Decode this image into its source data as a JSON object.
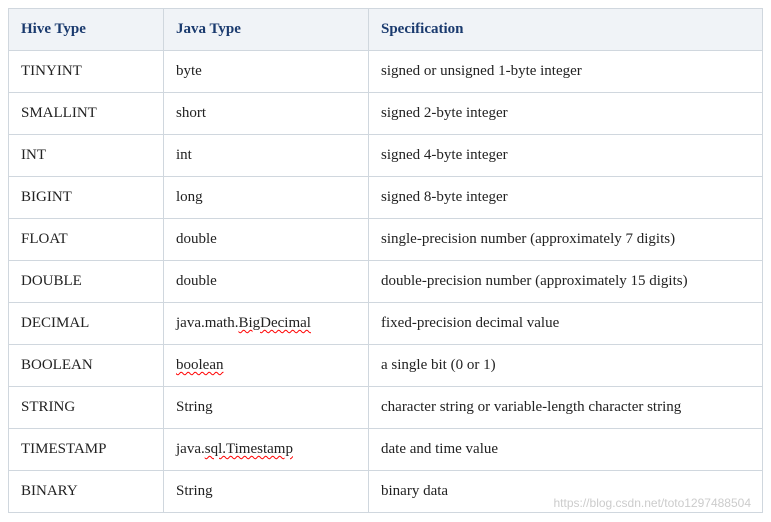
{
  "chart_data": {
    "type": "table",
    "headers": [
      "Hive Type",
      "Java Type",
      "Specification"
    ],
    "rows": [
      {
        "hive": "TINYINT",
        "java": "byte",
        "spec": "signed or unsigned 1-byte integer"
      },
      {
        "hive": "SMALLINT",
        "java": "short",
        "spec": "signed 2-byte integer"
      },
      {
        "hive": "INT",
        "java": "int",
        "spec": "signed 4-byte integer"
      },
      {
        "hive": "BIGINT",
        "java": "long",
        "spec": "signed 8-byte integer"
      },
      {
        "hive": "FLOAT",
        "java": "double",
        "spec": "single-precision number (approximately 7 digits)"
      },
      {
        "hive": "DOUBLE",
        "java": "double",
        "spec": "double-precision number (approximately 15 digits)"
      },
      {
        "hive": "DECIMAL",
        "java": "java.math.BigDecimal",
        "spec": "fixed-precision decimal value"
      },
      {
        "hive": "BOOLEAN",
        "java": "boolean",
        "spec": "a single bit (0 or 1)"
      },
      {
        "hive": "STRING",
        "java": "String",
        "spec": "character string or variable-length character string"
      },
      {
        "hive": "TIMESTAMP",
        "java": "java.sql.Timestamp",
        "spec": "date and time value"
      },
      {
        "hive": "BINARY",
        "java": "String",
        "spec": "binary data"
      }
    ]
  },
  "watermark": "https://blog.csdn.net/toto1297488504"
}
